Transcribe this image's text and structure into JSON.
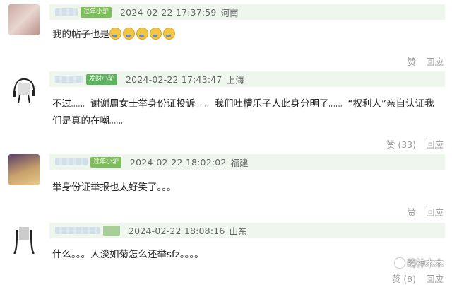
{
  "comments": [
    {
      "badge": "过年小驴",
      "time": "2024-02-22 17:37:59",
      "location": "河南",
      "text": "我的帖子也是",
      "emoji_count": 5,
      "like_label": "赞",
      "reply_label": "回应"
    },
    {
      "badge": "发财小驴",
      "time": "2024-02-22 17:43:47",
      "location": "上海",
      "text": "不过。。。谢谢周女士举身份证投诉。。。我们吐槽乐子人此身分明了。。。“权利人”亲自认证我们是真的在嘲。。。",
      "like_label": "赞 (33)",
      "reply_label": "回应"
    },
    {
      "badge": "过年小驴",
      "time": "2024-02-22 18:02:02",
      "location": "福建",
      "text": "举身份证举报也太好笑了。。。",
      "like_label": "赞",
      "reply_label": "回应"
    },
    {
      "badge": "",
      "time": "2024-02-22 18:08:16",
      "location": "山东",
      "text": "什么。。。人淡如菊怎么还举sfz。。。。",
      "like_label": "赞 (8)",
      "reply_label": "回应"
    }
  ],
  "watermark": "萌神木木",
  "colors": {
    "meta_bg": "#eef6ee",
    "badge_green": "#7dbd5a",
    "action_gray": "#999999"
  }
}
